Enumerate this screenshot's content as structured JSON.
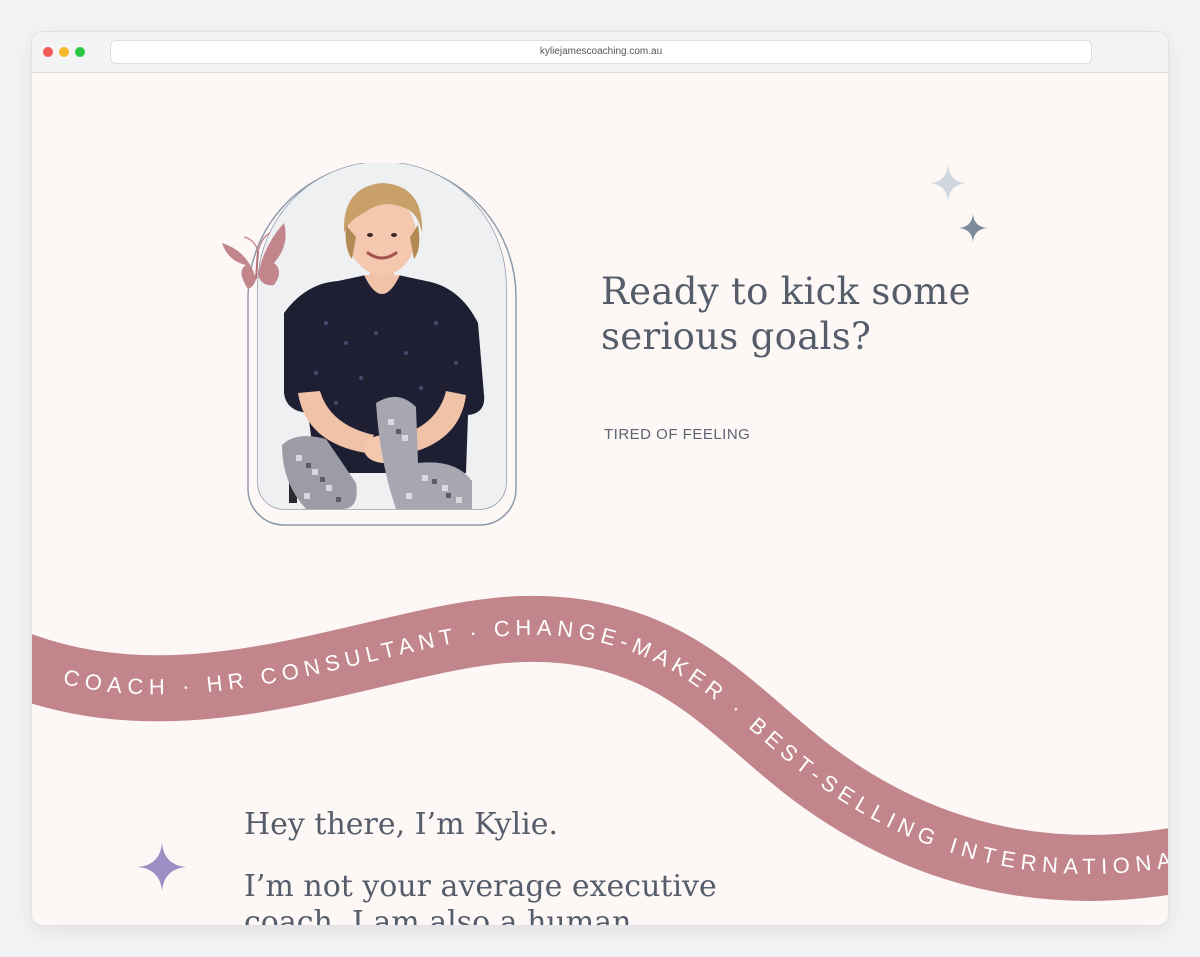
{
  "browser": {
    "url": "kyliejamescoaching.com.au"
  },
  "hero": {
    "headline_line1": "Ready to kick some",
    "headline_line2": "serious goals?",
    "subline": "TIRED OF FEELING"
  },
  "ribbon": {
    "text": "COACH · HR CONSULTANT · CHANGE-MAKER · BEST-SELLING INTERNATIONAL",
    "color": "#c1858b",
    "text_color": "#ffffff"
  },
  "intro": {
    "title": "Hey there, I’m Kylie.",
    "body": "I’m not your average executive coach. I am also a human resources"
  },
  "colors": {
    "page_background": "#fdf8f6",
    "text": "#555d6b",
    "frame": "#8e9aab",
    "butterfly": "#c1858b",
    "sparkle_light": "#cfd6dd",
    "sparkle_dark": "#7c8a9c",
    "sparkle_purple": "#9b8fc4"
  },
  "icons": {
    "butterfly": "butterfly-icon",
    "sparkles": [
      "sparkle-icon",
      "sparkle-icon",
      "sparkle-icon"
    ]
  }
}
